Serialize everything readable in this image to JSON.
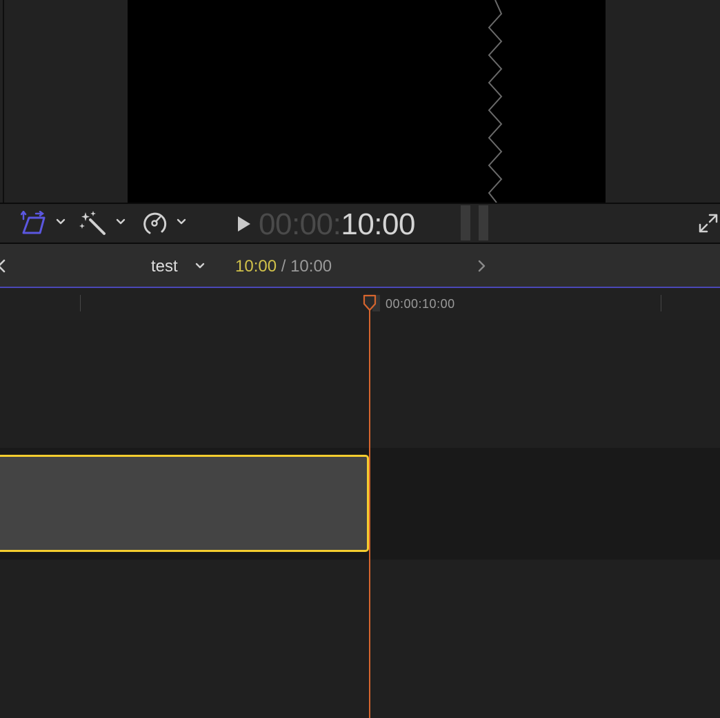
{
  "viewer": {
    "timecode_dim": "00:00:",
    "timecode_bright": "10:00"
  },
  "toolbar": {
    "icons": {
      "transform": "transform-icon",
      "enhance": "magic-wand-icon",
      "retime": "speedometer-icon",
      "play": "play-icon",
      "fullscreen": "fullscreen-icon"
    },
    "accent_color": "#5b57e0"
  },
  "timeline_header": {
    "project_name": "test",
    "duration_current": "10:00",
    "duration_separator": " / ",
    "duration_total": "10:00",
    "duration_color": "#d1c24a"
  },
  "timeline": {
    "ruler_label": "00:00:10:00",
    "clip_selected_color": "#f5cd2f",
    "playhead_color": "#d6652e"
  }
}
